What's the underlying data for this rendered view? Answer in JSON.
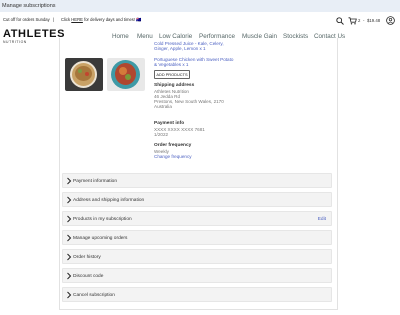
{
  "window": {
    "tab_title": "Manage subscriptions"
  },
  "announcement": {
    "cutoff": "Cut off for orders Sunday",
    "separator": "|",
    "delivery_prefix": "Click",
    "delivery_link": "HERE",
    "delivery_suffix": "for delivery days and times!",
    "flag": "🇦🇺"
  },
  "brand": {
    "name": "ATHLETES",
    "tagline": "NUTRITION"
  },
  "nav": {
    "items": [
      {
        "label": "Home"
      },
      {
        "label": "Menu"
      },
      {
        "label": "Low Calorie"
      },
      {
        "label": "Performance"
      },
      {
        "label": "Muscle Gain"
      },
      {
        "label": "Stockists"
      },
      {
        "label": "Contact Us"
      }
    ]
  },
  "header": {
    "cart_count": "2",
    "cart_separator": "-",
    "cart_total": "$19.48"
  },
  "subscription": {
    "product_text_1": "Cold Pressed Juice - Kale, Celery, Ginger, Apple, Lemon x 1",
    "product_text_2": "Portuguese Chicken with Sweet Potato & Vegetables x 1",
    "add_products_label": "ADD PRODUCTS",
    "shipping_label": "Shipping address",
    "shipping_lines": [
      "Athletes Nutrition",
      "46 Jedda Rd",
      "Prestons, New South Wales, 2170",
      "Australia"
    ],
    "payment_label": "Payment info",
    "payment_card": "XXXX XXXX XXXX 7681",
    "payment_expiry": "1/2022",
    "frequency_label": "Order frequency",
    "frequency_value": "Weekly",
    "change_frequency_label": "Change frequency"
  },
  "accordion": [
    {
      "label": "Payment information"
    },
    {
      "label": "Address and shipping information"
    },
    {
      "label": "Products in my subscription",
      "action": "Edit"
    },
    {
      "label": "Manage upcoming orders"
    },
    {
      "label": "Order history"
    },
    {
      "label": "Discount code"
    },
    {
      "label": "Cancel subscription"
    }
  ],
  "colors": {
    "link": "#4a5fc1",
    "accordion_bg": "#f3f3f3"
  },
  "icons": [
    "search-icon",
    "cart-icon",
    "user-icon",
    "chevron-right-icon"
  ]
}
